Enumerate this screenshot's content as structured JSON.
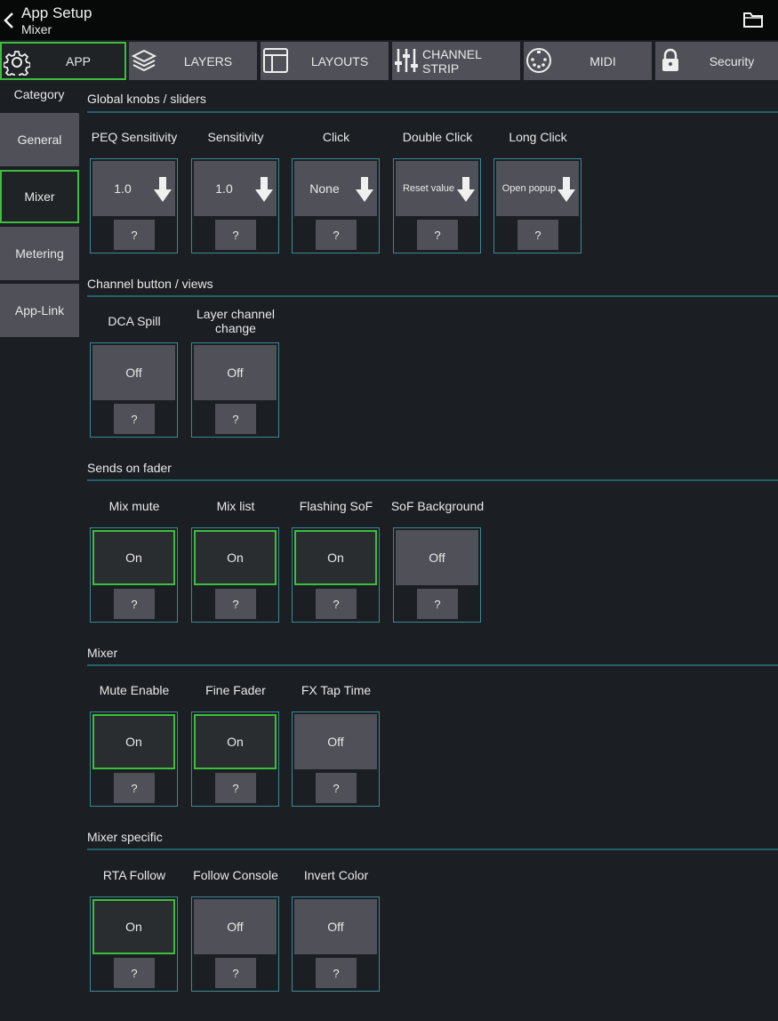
{
  "header": {
    "title": "App Setup",
    "subtitle": "Mixer"
  },
  "tabs": [
    {
      "label": "APP",
      "icon": "gear-icon"
    },
    {
      "label": "LAYERS",
      "icon": "layers-icon"
    },
    {
      "label": "LAYOUTS",
      "icon": "layout-icon"
    },
    {
      "label": "CHANNEL STRIP",
      "icon": "sliders-icon"
    },
    {
      "label": "MIDI",
      "icon": "midi-icon"
    },
    {
      "label": "Security",
      "icon": "lock-icon"
    }
  ],
  "sidebar": {
    "heading": "Category",
    "items": [
      {
        "label": "General"
      },
      {
        "label": "Mixer"
      },
      {
        "label": "Metering"
      },
      {
        "label": "App-Link"
      }
    ]
  },
  "sections": [
    {
      "title": "Global knobs / sliders",
      "controls": [
        {
          "label": "PEQ Sensitivity",
          "value": "1.0",
          "help": "?"
        },
        {
          "label": "Sensitivity",
          "value": "1.0",
          "help": "?"
        },
        {
          "label": "Click",
          "value": "None",
          "help": "?"
        },
        {
          "label": "Double Click",
          "value": "Reset value",
          "help": "?"
        },
        {
          "label": "Long Click",
          "value": "Open popup",
          "help": "?"
        }
      ]
    },
    {
      "title": "Channel button / views",
      "controls": [
        {
          "label": "DCA Spill",
          "value": "Off",
          "help": "?"
        },
        {
          "label": "Layer channel change",
          "value": "Off",
          "help": "?"
        }
      ]
    },
    {
      "title": "Sends on fader",
      "controls": [
        {
          "label": "Mix mute",
          "value": "On",
          "help": "?"
        },
        {
          "label": "Mix list",
          "value": "On",
          "help": "?"
        },
        {
          "label": "Flashing SoF",
          "value": "On",
          "help": "?"
        },
        {
          "label": "SoF Background",
          "value": "Off",
          "help": "?"
        }
      ]
    },
    {
      "title": "Mixer",
      "controls": [
        {
          "label": "Mute Enable",
          "value": "On",
          "help": "?"
        },
        {
          "label": "Fine Fader",
          "value": "On",
          "help": "?"
        },
        {
          "label": "FX Tap Time",
          "value": "Off",
          "help": "?"
        }
      ]
    },
    {
      "title": "Mixer specific",
      "controls": [
        {
          "label": "RTA Follow",
          "value": "On",
          "help": "?"
        },
        {
          "label": "Follow Console",
          "value": "Off",
          "help": "?"
        },
        {
          "label": "Invert Color",
          "value": "Off",
          "help": "?"
        }
      ]
    }
  ],
  "colors": {
    "accent_green": "#3cbf3c",
    "frame_teal": "#3c8a96",
    "button_grey": "#505058",
    "background": "#1b1e22"
  }
}
